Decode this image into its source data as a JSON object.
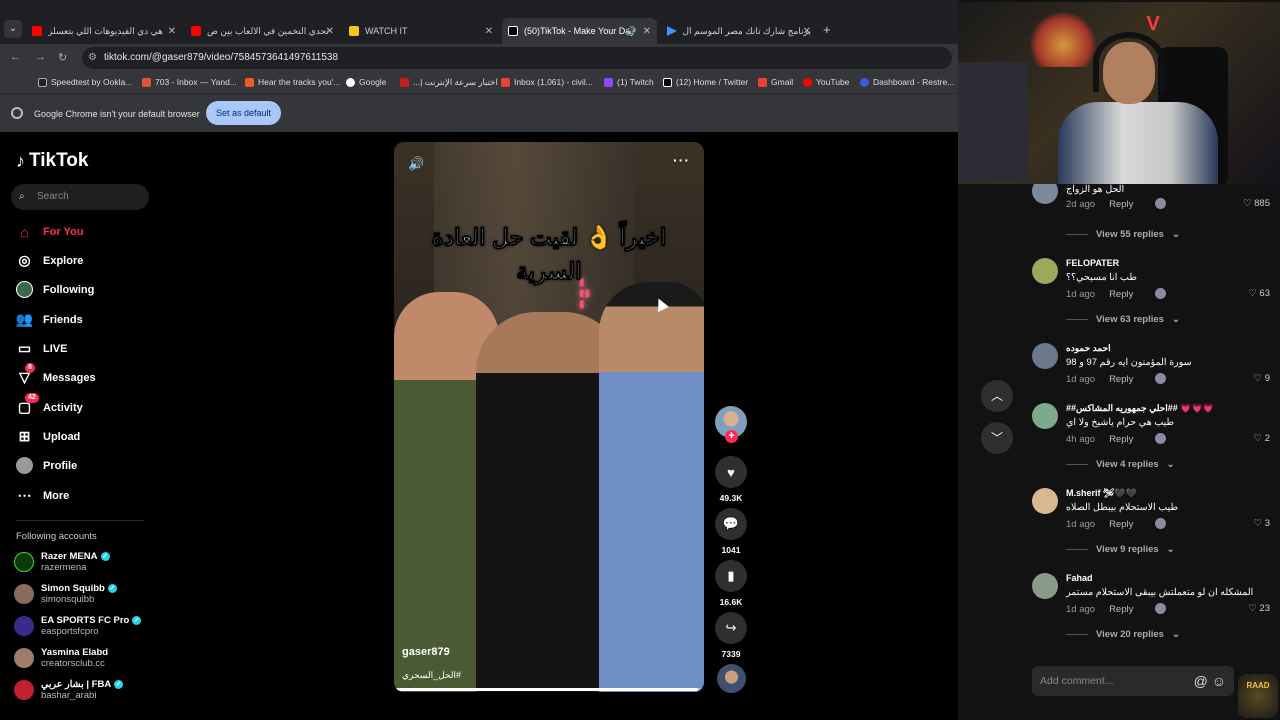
{
  "browser": {
    "tabs": [
      {
        "title": "هي دي الفيديوهات اللي بتعسلز",
        "fav_color": "#ff0000"
      },
      {
        "title": "تحدي التخمين في الالعاب بين ص",
        "fav_color": "#ff0000"
      },
      {
        "title": "WATCH IT",
        "fav_color": "#f5c518"
      },
      {
        "title": "(50)TikTok - Make Your Day",
        "fav_color": "#ffffff"
      },
      {
        "title": "برنامج شارك تانك مصر الموسم ال",
        "fav_color": "#4a8cff"
      }
    ],
    "url": "tiktok.com/@gaser879/video/7584573641497611538",
    "bookmarks": [
      "Speedtest by Ookla...",
      "703 - Inbox — Yand...",
      "Hear the tracks you'...",
      "Google",
      "اختبار سرعة الإنترنت |...",
      "Inbox (1,061) - civil...",
      "(1) Twitch",
      "(12) Home / Twitter",
      "Gmail",
      "YouTube",
      "Dashboard - Restre..."
    ],
    "infobar_text": "Google Chrome isn't your default browser",
    "infobar_button": "Set as default"
  },
  "tiktok": {
    "logo": "TikTok",
    "search_placeholder": "Search",
    "nav": [
      {
        "label": "For You",
        "icon": "home-icon",
        "active": true
      },
      {
        "label": "Explore",
        "icon": "compass-icon"
      },
      {
        "label": "Following",
        "icon": "following-avatar-icon"
      },
      {
        "label": "Friends",
        "icon": "friends-icon"
      },
      {
        "label": "LIVE",
        "icon": "live-icon"
      },
      {
        "label": "Messages",
        "icon": "messages-icon",
        "badge": "8"
      },
      {
        "label": "Activity",
        "icon": "activity-icon",
        "badge": "42"
      },
      {
        "label": "Upload",
        "icon": "upload-icon"
      },
      {
        "label": "Profile",
        "icon": "profile-icon"
      },
      {
        "label": "More",
        "icon": "more-icon"
      }
    ],
    "following_title": "Following accounts",
    "accounts": [
      {
        "name": "Razer MENA",
        "handle": "razermena",
        "color": "#0a3a0a"
      },
      {
        "name": "Simon Squibb",
        "handle": "simonsquibb",
        "color": "#8a6a5a"
      },
      {
        "name": "EA SPORTS FC Pro",
        "handle": "easportsfcpro",
        "color": "#3a2a8a"
      },
      {
        "name": "Yasmina Elabd",
        "handle": "creatorsclub.cc",
        "color": "#a07a6a"
      },
      {
        "name": "بشار عربي | FBA",
        "handle": "bashar_arabi",
        "color": "#c02030"
      }
    ]
  },
  "video": {
    "caption_overlay": "اخيراً 👌 لقيت حل العادة السرية",
    "author": "gaser879",
    "hashtag": "#الحل_السحري",
    "likes": "49.3K",
    "comments": "1041",
    "saves": "16.6K",
    "shares": "7339",
    "progress": 0.98
  },
  "comments": [
    {
      "name": "",
      "text": "الحل هو الزواج",
      "date": "2d ago",
      "likes": "885",
      "view_replies": "View 55 replies",
      "color": "#7a8a9a"
    },
    {
      "name": "FELOPATER",
      "text": "طب انا مسيحي؟؟",
      "date": "1d ago",
      "likes": "63",
      "view_replies": "View 63 replies",
      "color": "#9aaa5a"
    },
    {
      "name": "احمد حموده",
      "text": "سورة المؤمنون ايه رقم 97 و 98",
      "date": "1d ago",
      "likes": "9",
      "view_replies": "",
      "color": "#6a7a8a"
    },
    {
      "name": "##احلي جمهوريه المشاكس## 💗💗💗",
      "text": "طيب هي حرام ياشيخ ولا اي",
      "date": "4h ago",
      "likes": "2",
      "view_replies": "View 4 replies",
      "color": "#7aaa8a"
    },
    {
      "name": "M.sherif 🛩🖤🖤",
      "text": "طيب الاستحلام بيبطل الصلاه",
      "date": "1d ago",
      "likes": "3",
      "view_replies": "View 9 replies",
      "color": "#d8b890"
    },
    {
      "name": "Fahad",
      "text": "المشكله ان لو متعملتش بيبقى الاستحلام مستمر",
      "date": "1d ago",
      "likes": "23",
      "view_replies": "View 20 replies",
      "color": "#8a9a8a"
    }
  ],
  "comment_input_placeholder": "Add comment...",
  "reply_label": "Reply",
  "watermark": "RAAD"
}
